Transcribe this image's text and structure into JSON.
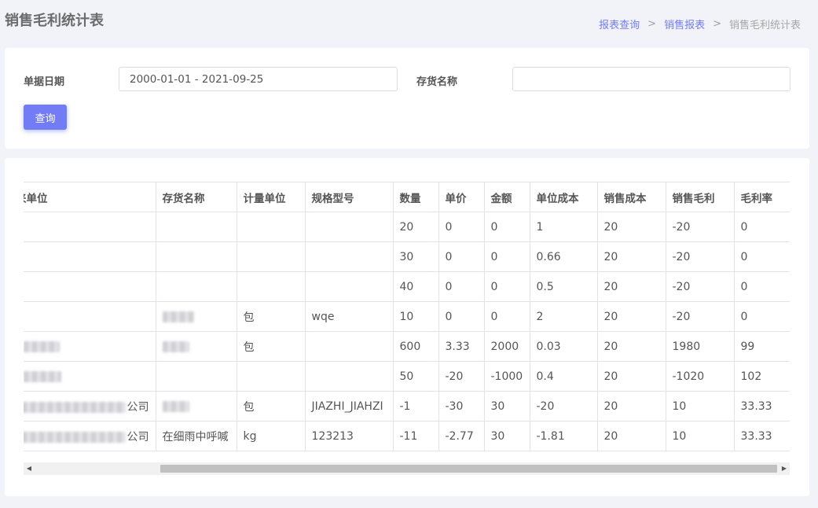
{
  "header": {
    "title": "销售毛利统计表",
    "breadcrumb": [
      "报表查询",
      "销售报表",
      "销售毛利统计表"
    ],
    "separator": ">"
  },
  "filters": {
    "date_label": "单据日期",
    "date_value": "2000-01-01 - 2021-09-25",
    "name_label": "存货名称",
    "name_value": "",
    "query_button": "查询"
  },
  "table": {
    "columns": [
      "来单位",
      "存货名称",
      "计量单位",
      "规格型号",
      "数量",
      "单价",
      "金额",
      "单位成本",
      "销售成本",
      "销售毛利",
      "毛利率"
    ],
    "rows": [
      [
        "",
        "",
        "",
        "",
        "20",
        "0",
        "0",
        "1",
        "20",
        "-20",
        "0"
      ],
      [
        "",
        "",
        "",
        "",
        "30",
        "0",
        "0",
        "0.66",
        "20",
        "-20",
        "0"
      ],
      [
        "",
        "",
        "",
        "",
        "40",
        "0",
        "0",
        "0.5",
        "20",
        "-20",
        "0"
      ],
      [
        "",
        "",
        "包",
        "wqe",
        "10",
        "0",
        "0",
        "2",
        "20",
        "-20",
        "0"
      ],
      [
        "",
        "",
        "包",
        "",
        "600",
        "3.33",
        "2000",
        "0.03",
        "20",
        "1980",
        "99"
      ],
      [
        "",
        "",
        "",
        "",
        "50",
        "-20",
        "-1000",
        "0.4",
        "20",
        "-1020",
        "102"
      ],
      [
        "公司",
        "",
        "包",
        "JIAZHI_JIAHZI",
        "-1",
        "-30",
        "30",
        "-20",
        "20",
        "10",
        "33.33"
      ],
      [
        "公司",
        "在细雨中呼喊",
        "kg",
        "123213",
        "-11",
        "-2.77",
        "30",
        "-1.81",
        "20",
        "10",
        "33.33"
      ]
    ]
  },
  "scrollbar": {
    "left_arrow": "◀",
    "right_arrow": "▶"
  },
  "colors": {
    "accent": "#727cf5",
    "background": "#f2f3f8",
    "border": "#e2e3ea"
  }
}
